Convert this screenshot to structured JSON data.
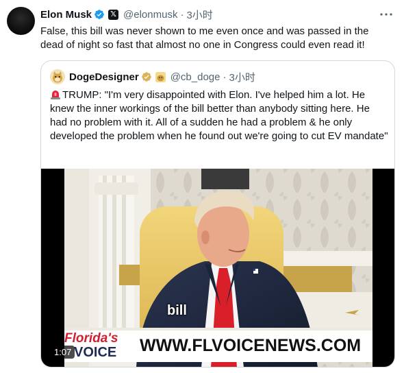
{
  "tweet": {
    "author_name": "Elon Musk",
    "author_handle": "@elonmusk",
    "separator": "·",
    "time": "3小时",
    "text": "False, this bill was never shown to me even once and was passed in the dead of night so fast that almost no one in Congress could even read it!"
  },
  "quoted": {
    "author_name": "DogeDesigner",
    "author_handle": "@cb_doge",
    "separator": "·",
    "time": "3小时",
    "text": "TRUMP: \"I'm very disappointed with Elon. I've helped him a lot. He knew the inner workings of the bill better than anybody sitting here. He had no problem with it. All of a sudden he had a problem & he only developed the problem when he found out we're going to cut EV mandate\""
  },
  "video": {
    "caption": "bill",
    "banner_logo_line1": "Florida's",
    "banner_logo_line2": "VOICE",
    "banner_url": "WWW.FLVOICENEWS.COM",
    "duration": "1:07"
  },
  "colors": {
    "verified_blue": "#1d9bf0",
    "gold_badge": "#d9b45a",
    "secondary_text": "#536471",
    "border": "#cfd9de"
  }
}
